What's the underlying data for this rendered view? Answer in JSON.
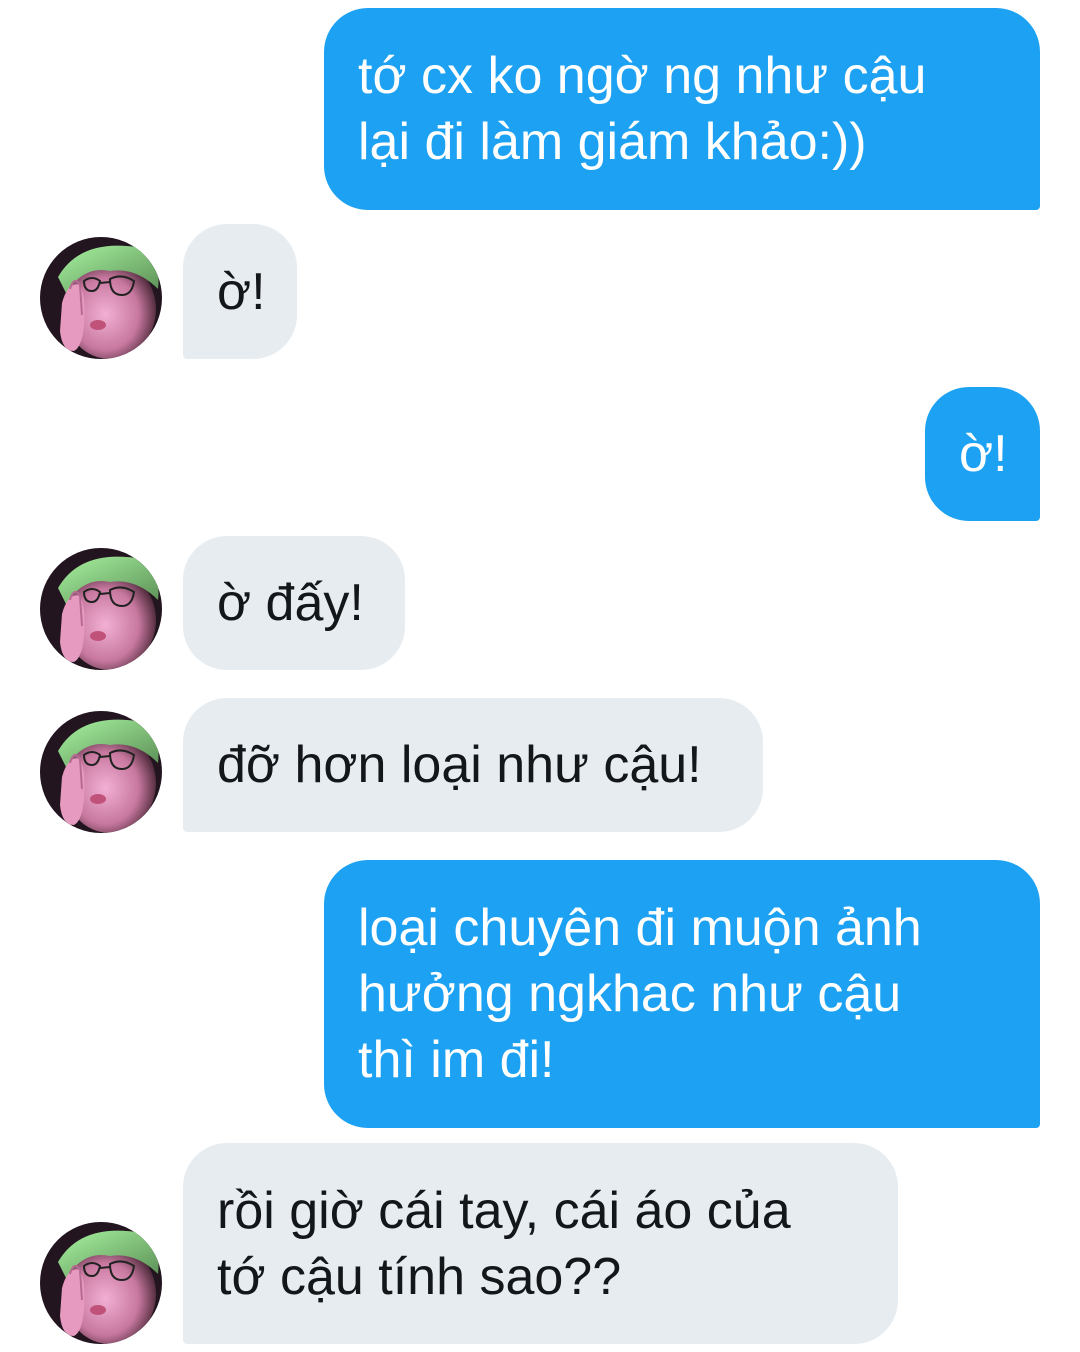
{
  "conversation": {
    "messages": [
      {
        "sender": "me",
        "lines": [
          "tớ cx ko ngờ ng như cậu",
          "lại đi làm giám khảo:))"
        ]
      },
      {
        "sender": "them",
        "lines": [
          "ờ!"
        ]
      },
      {
        "sender": "me",
        "lines": [
          "ờ!"
        ]
      },
      {
        "sender": "them",
        "lines": [
          "ờ đấy!"
        ]
      },
      {
        "sender": "them",
        "lines": [
          "đỡ hơn loại như cậu!"
        ]
      },
      {
        "sender": "me",
        "lines": [
          "loại chuyên đi muộn ảnh",
          "hưởng ngkhac như cậu",
          "thì im đi!"
        ]
      },
      {
        "sender": "them",
        "lines": [
          "rồi giờ cái tay, cái áo của",
          "tớ cậu tính sao??"
        ]
      }
    ]
  },
  "colors": {
    "outgoing_bubble": "#1da1f2",
    "incoming_bubble": "#e6ecf0",
    "outgoing_text": "#ffffff",
    "incoming_text": "#14171a",
    "background": "#ffffff"
  },
  "icons": {
    "avatar": "contact-avatar-photo"
  }
}
